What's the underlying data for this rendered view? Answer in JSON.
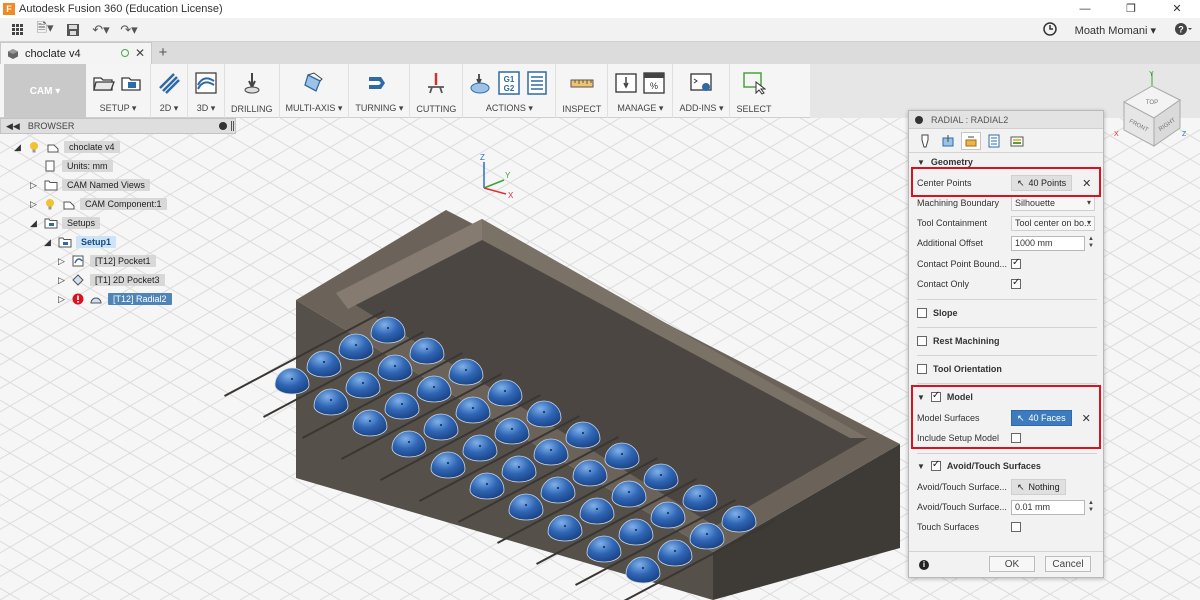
{
  "window": {
    "title": "Autodesk Fusion 360 (Education License)",
    "app_icon": "F"
  },
  "quickbar": {
    "user": "Moath Momani"
  },
  "document": {
    "tab_name": "choclate v4"
  },
  "toolbar": {
    "workspace": "CAM",
    "groups": {
      "setup": "SETUP",
      "g2d": "2D",
      "g3d": "3D",
      "drilling": "DRILLING",
      "multiaxis": "MULTI-AXIS",
      "turning": "TURNING",
      "cutting": "CUTTING",
      "actions": "ACTIONS",
      "inspect": "INSPECT",
      "manage": "MANAGE",
      "addins": "ADD-INS",
      "select": "SELECT"
    },
    "g1g2_top": "G1",
    "g1g2_bottom": "G2"
  },
  "browser": {
    "title": "BROWSER",
    "nodes": {
      "root": "choclate v4",
      "units": "Units: mm",
      "named_views": "CAM Named Views",
      "component": "CAM Component:1",
      "setups": "Setups",
      "setup1": "Setup1",
      "pocket1": "[T12] Pocket1",
      "pocket3": "[T1] 2D Pocket3",
      "radial2": "[T12] Radial2"
    }
  },
  "panel": {
    "title": "RADIAL : RADIAL2",
    "geometry": {
      "header": "Geometry",
      "center_points_label": "Center Points",
      "center_points_value": "40 Points",
      "boundary_label": "Machining Boundary",
      "boundary_value": "Silhouette",
      "containment_label": "Tool Containment",
      "containment_value": "Tool center on bo...",
      "offset_label": "Additional Offset",
      "offset_value": "1000 mm",
      "contact_bound_label": "Contact Point Bound...",
      "contact_only_label": "Contact Only"
    },
    "slope": "Slope",
    "rest": "Rest Machining",
    "orientation": "Tool Orientation",
    "model": {
      "header": "Model",
      "surfaces_label": "Model Surfaces",
      "surfaces_value": "40 Faces",
      "include_label": "Include Setup Model"
    },
    "avoid": {
      "header": "Avoid/Touch Surfaces",
      "row1_label": "Avoid/Touch Surface...",
      "row1_value": "Nothing",
      "row2_label": "Avoid/Touch Surface...",
      "row2_value": "0.01 mm",
      "touch_label": "Touch Surfaces"
    },
    "ok": "OK",
    "cancel": "Cancel"
  },
  "viewcube": {
    "top": "TOP",
    "front": "FRONT",
    "right": "RIGHT"
  },
  "axes": {
    "z": "Z",
    "y": "Y",
    "x": "X"
  },
  "colors": {
    "highlight": "#d8121f",
    "selection": "#3c7bbd",
    "part": "#6b6359"
  }
}
